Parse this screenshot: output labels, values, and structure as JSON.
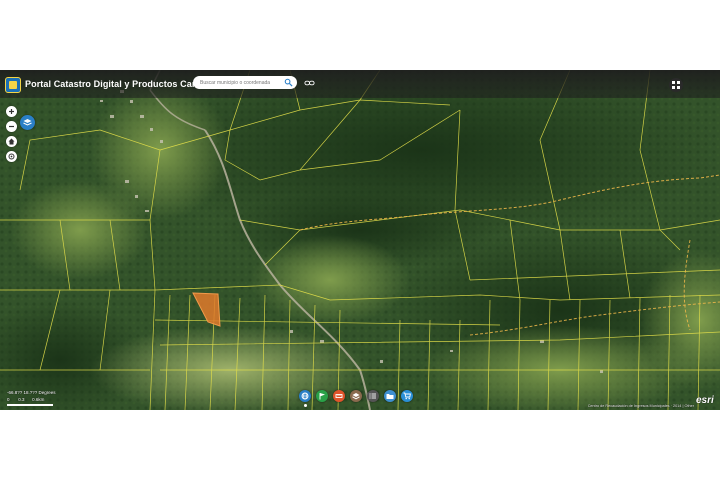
{
  "app": {
    "title": "Portal Catastro Digital y Productos Cartográficos",
    "logo_name": "catastro-logo"
  },
  "search": {
    "placeholder": "Buscar municipio o coordenada",
    "icon": "search-icon"
  },
  "header_icons": {
    "link": "link-icon",
    "apps": "grid-icon"
  },
  "map_controls": {
    "zoom_in": "plus-icon",
    "zoom_out": "minus-icon",
    "home": "home-icon",
    "locate": "target-icon",
    "basemap": "layers-icon"
  },
  "status": {
    "coordinates": "-66.8?? 18.??? Degrees",
    "scale_values": [
      "0",
      "0.3",
      "0.6km"
    ]
  },
  "toolbar": {
    "tools": [
      {
        "name": "basemap-gallery",
        "icon": "globe-icon",
        "color": "#2a7fc7"
      },
      {
        "name": "bookmarks",
        "icon": "flag-icon",
        "color": "#2aa148"
      },
      {
        "name": "measure",
        "icon": "ruler-icon",
        "color": "#e0542b"
      },
      {
        "name": "layers",
        "icon": "layers-icon",
        "color": "#8a6a4e"
      },
      {
        "name": "legend",
        "icon": "list-icon",
        "color": "#555555"
      },
      {
        "name": "print",
        "icon": "folder-icon",
        "color": "#3d8fd0"
      },
      {
        "name": "cart",
        "icon": "cart-icon",
        "color": "#2a8fd6"
      }
    ]
  },
  "attribution": {
    "text": "Centro de Recaudación de Ingresos Municipales · 2014 | Other"
  },
  "branding": {
    "esri": "esri"
  },
  "colors": {
    "parcel_line": "#e4e04a",
    "selected_parcel": "#e07a2c",
    "dashed_boundary": "#f0b84a",
    "forest": "#2b4a24",
    "pasture": "#6f8f46",
    "toolbar_bg": "#2a2a2a"
  }
}
